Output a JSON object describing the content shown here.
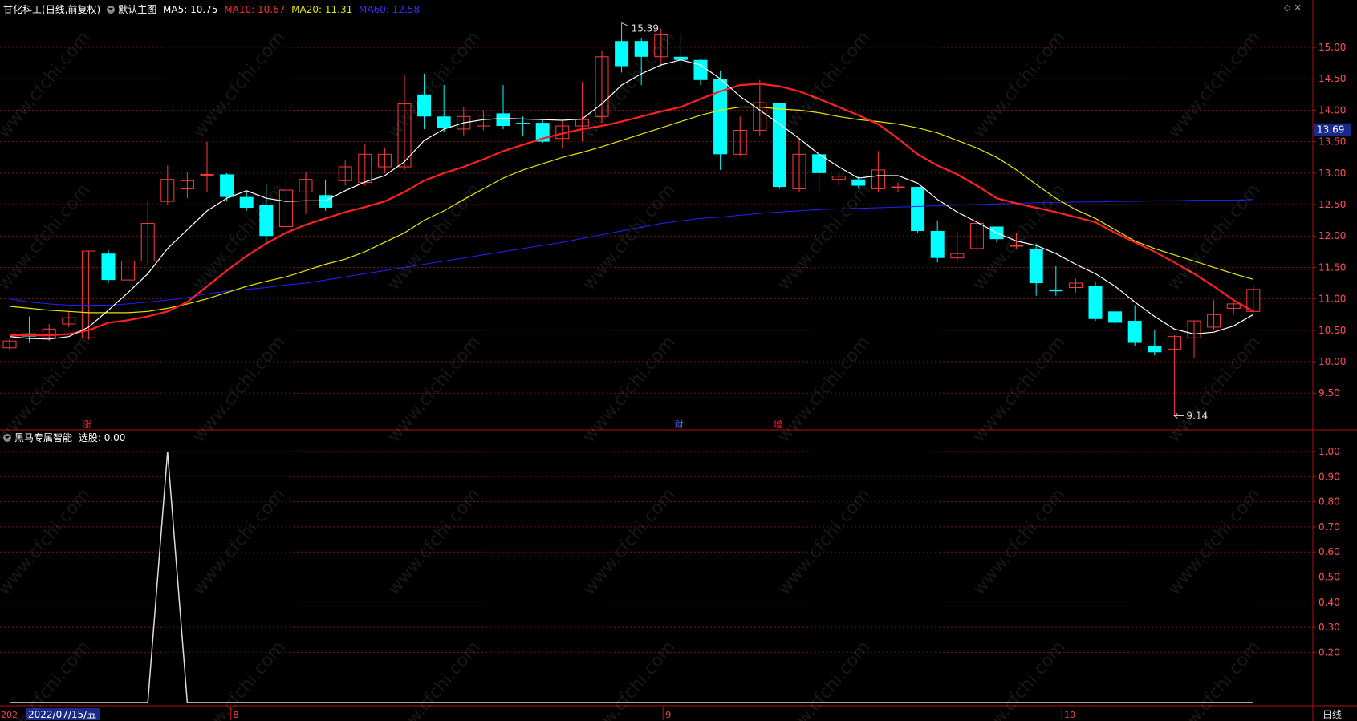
{
  "header": {
    "stock_name": "甘化科工",
    "period_label": "(日线,前复权)",
    "main_label": "默认主图",
    "ma5": "MA5: 10.75",
    "ma10": "MA10: 10.67",
    "ma20": "MA20: 11.31",
    "ma60": "MA60: 12.58"
  },
  "sub_header": {
    "indicator": "黑马专属智能",
    "value": "选股: 0.00"
  },
  "bottom_bar": {
    "date": "2022/07/15/五",
    "date_prefix": "202",
    "period": "日线"
  },
  "colors": {
    "up": "#ff3b3b",
    "down": "#00ffff",
    "ma5": "#ffffff",
    "ma10": "#ff2020",
    "ma20": "#e6e600",
    "ma60": "#2222ff",
    "grid": "#7a1010"
  },
  "events": [
    "涨",
    "财",
    "增"
  ],
  "watermark": "www.cfchi.com",
  "chart_data": [
    {
      "type": "candlestick",
      "y_axis_ticks": [
        "15.00",
        "14.50",
        "14.00",
        "13.50",
        "13.00",
        "12.50",
        "12.00",
        "11.50",
        "11.00",
        "10.50",
        "10.00",
        "9.50"
      ],
      "ylim": [
        9.0,
        15.6
      ],
      "current_price_label": "13.69",
      "high_label": "15.39",
      "low_label": "9.14",
      "x_tick_labels": [
        "8",
        "9",
        "10"
      ],
      "candles": [
        [
          10.22,
          10.33,
          10.17,
          10.38
        ],
        [
          10.45,
          10.4,
          10.3,
          10.72
        ],
        [
          10.38,
          10.52,
          10.33,
          10.6
        ],
        [
          10.6,
          10.7,
          10.55,
          10.8
        ],
        [
          10.38,
          11.76,
          10.35,
          11.76
        ],
        [
          11.72,
          11.3,
          11.25,
          11.78
        ],
        [
          11.3,
          11.6,
          11.28,
          11.68
        ],
        [
          11.6,
          12.2,
          11.55,
          12.55
        ],
        [
          12.55,
          12.9,
          12.5,
          13.12
        ],
        [
          12.75,
          12.88,
          12.6,
          13.02
        ],
        [
          12.98,
          12.98,
          12.7,
          13.5
        ],
        [
          12.98,
          12.62,
          12.55,
          13.0
        ],
        [
          12.62,
          12.45,
          12.4,
          12.7
        ],
        [
          12.5,
          12.0,
          11.88,
          12.82
        ],
        [
          12.15,
          12.73,
          12.1,
          12.9
        ],
        [
          12.7,
          12.9,
          12.35,
          13.02
        ],
        [
          12.65,
          12.45,
          12.4,
          12.9
        ],
        [
          12.88,
          13.1,
          12.8,
          13.2
        ],
        [
          12.85,
          13.3,
          12.8,
          13.46
        ],
        [
          13.1,
          13.3,
          13.0,
          13.4
        ],
        [
          13.1,
          14.1,
          13.05,
          14.56
        ],
        [
          14.25,
          13.9,
          13.7,
          14.58
        ],
        [
          13.9,
          13.72,
          13.65,
          14.4
        ],
        [
          13.7,
          13.9,
          13.6,
          14.05
        ],
        [
          13.75,
          13.92,
          13.68,
          14.0
        ],
        [
          13.95,
          13.75,
          13.7,
          14.4
        ],
        [
          13.8,
          13.78,
          13.6,
          13.9
        ],
        [
          13.8,
          13.5,
          13.48,
          13.85
        ],
        [
          13.55,
          13.75,
          13.4,
          13.85
        ],
        [
          13.75,
          13.85,
          13.5,
          14.45
        ],
        [
          13.9,
          14.85,
          13.8,
          14.95
        ],
        [
          15.1,
          14.7,
          14.6,
          15.39
        ],
        [
          15.1,
          14.85,
          14.4,
          15.15
        ],
        [
          14.85,
          15.2,
          14.7,
          15.3
        ],
        [
          14.85,
          14.8,
          14.7,
          15.22
        ],
        [
          14.8,
          14.48,
          14.4,
          14.82
        ],
        [
          14.5,
          13.3,
          13.05,
          14.62
        ],
        [
          13.3,
          13.68,
          13.28,
          13.9
        ],
        [
          13.68,
          14.12,
          13.6,
          14.48
        ],
        [
          14.12,
          12.78,
          12.75,
          14.12
        ],
        [
          12.75,
          13.3,
          12.7,
          13.55
        ],
        [
          13.3,
          13.0,
          12.7,
          13.3
        ],
        [
          12.9,
          12.95,
          12.8,
          13.0
        ],
        [
          12.9,
          12.8,
          12.75,
          12.95
        ],
        [
          12.75,
          13.05,
          12.7,
          13.35
        ],
        [
          12.78,
          12.78,
          12.7,
          12.85
        ],
        [
          12.78,
          12.08,
          12.05,
          12.78
        ],
        [
          12.08,
          11.65,
          11.58,
          12.25
        ],
        [
          11.65,
          11.72,
          11.6,
          12.05
        ],
        [
          11.8,
          12.2,
          11.78,
          12.35
        ],
        [
          12.15,
          11.95,
          11.9,
          12.15
        ],
        [
          11.85,
          11.85,
          11.8,
          12.05
        ],
        [
          11.8,
          11.25,
          11.05,
          11.88
        ],
        [
          11.15,
          11.12,
          11.05,
          11.52
        ],
        [
          11.18,
          11.25,
          11.1,
          11.32
        ],
        [
          11.2,
          10.68,
          10.65,
          11.28
        ],
        [
          10.8,
          10.62,
          10.55,
          10.82
        ],
        [
          10.65,
          10.3,
          10.25,
          10.9
        ],
        [
          10.25,
          10.15,
          10.1,
          10.5
        ],
        [
          10.2,
          10.4,
          9.14,
          10.42
        ],
        [
          10.38,
          10.65,
          10.05,
          10.65
        ],
        [
          10.55,
          10.75,
          10.5,
          10.98
        ],
        [
          10.85,
          10.92,
          10.75,
          10.95
        ],
        [
          10.8,
          11.15,
          10.78,
          11.22
        ]
      ],
      "ma5": [
        10.4,
        10.37,
        10.36,
        10.4,
        10.55,
        10.82,
        11.1,
        11.4,
        11.8,
        12.1,
        12.4,
        12.6,
        12.72,
        12.6,
        12.55,
        12.56,
        12.56,
        12.72,
        12.86,
        12.96,
        13.18,
        13.52,
        13.7,
        13.8,
        13.85,
        13.87,
        13.86,
        13.85,
        13.84,
        13.86,
        14.1,
        14.4,
        14.58,
        14.72,
        14.8,
        14.72,
        14.5,
        14.22,
        14.0,
        13.78,
        13.55,
        13.3,
        13.1,
        12.92,
        12.96,
        12.96,
        12.84,
        12.58,
        12.38,
        12.22,
        12.05,
        11.92,
        11.85,
        11.72,
        11.55,
        11.4,
        11.2,
        10.95,
        10.72,
        10.52,
        10.44,
        10.47,
        10.57,
        10.75
      ],
      "ma10": [
        10.42,
        10.42,
        10.42,
        10.44,
        10.5,
        10.62,
        10.66,
        10.72,
        10.8,
        10.95,
        11.2,
        11.45,
        11.68,
        11.88,
        12.05,
        12.18,
        12.28,
        12.38,
        12.46,
        12.55,
        12.7,
        12.88,
        13.0,
        13.1,
        13.22,
        13.35,
        13.45,
        13.55,
        13.63,
        13.7,
        13.75,
        13.82,
        13.9,
        13.98,
        14.05,
        14.18,
        14.3,
        14.4,
        14.42,
        14.38,
        14.3,
        14.18,
        14.05,
        13.92,
        13.78,
        13.55,
        13.3,
        13.12,
        12.98,
        12.8,
        12.6,
        12.52,
        12.45,
        12.38,
        12.3,
        12.22,
        12.05,
        11.9,
        11.75,
        11.58,
        11.4,
        11.2,
        10.98,
        10.8,
        10.7,
        10.67,
        10.67
      ],
      "ma20": [
        10.88,
        10.85,
        10.82,
        10.8,
        10.78,
        10.78,
        10.78,
        10.8,
        10.85,
        10.92,
        11.0,
        11.1,
        11.2,
        11.28,
        11.35,
        11.45,
        11.55,
        11.63,
        11.75,
        11.9,
        12.05,
        12.25,
        12.4,
        12.58,
        12.75,
        12.92,
        13.05,
        13.15,
        13.25,
        13.33,
        13.42,
        13.52,
        13.62,
        13.72,
        13.82,
        13.92,
        14.0,
        14.05,
        14.05,
        14.02,
        14.0,
        13.96,
        13.9,
        13.85,
        13.82,
        13.78,
        13.72,
        13.64,
        13.52,
        13.4,
        13.25,
        13.05,
        12.82,
        12.6,
        12.42,
        12.28,
        12.1,
        11.92,
        11.8,
        11.7,
        11.6,
        11.5,
        11.4,
        11.31
      ],
      "ma60": [
        11.0,
        10.95,
        10.92,
        10.9,
        10.9,
        10.9,
        10.92,
        10.95,
        10.98,
        11.02,
        11.08,
        11.12,
        11.15,
        11.18,
        11.22,
        11.25,
        11.3,
        11.35,
        11.4,
        11.45,
        11.5,
        11.55,
        11.6,
        11.65,
        11.7,
        11.75,
        11.8,
        11.85,
        11.9,
        11.96,
        12.02,
        12.08,
        12.14,
        12.2,
        12.24,
        12.28,
        12.3,
        12.33,
        12.36,
        12.38,
        12.4,
        12.42,
        12.43,
        12.44,
        12.45,
        12.46,
        12.47,
        12.48,
        12.49,
        12.5,
        12.51,
        12.52,
        12.53,
        12.53,
        12.54,
        12.54,
        12.55,
        12.55,
        12.56,
        12.56,
        12.57,
        12.57,
        12.57,
        12.58
      ]
    },
    {
      "type": "line",
      "name": "选股",
      "ylim": [
        0,
        1.05
      ],
      "y_axis_ticks": [
        "1.00",
        "0.90",
        "0.80",
        "0.70",
        "0.60",
        "0.50",
        "0.40",
        "0.30",
        "0.20"
      ],
      "values": [
        0,
        0,
        0,
        0,
        0,
        0,
        0,
        0,
        1,
        0,
        0,
        0,
        0,
        0,
        0,
        0,
        0,
        0,
        0,
        0,
        0,
        0,
        0,
        0,
        0,
        0,
        0,
        0,
        0,
        0,
        0,
        0,
        0,
        0,
        0,
        0,
        0,
        0,
        0,
        0,
        0,
        0,
        0,
        0,
        0,
        0,
        0,
        0,
        0,
        0,
        0,
        0,
        0,
        0,
        0,
        0,
        0,
        0,
        0,
        0,
        0,
        0,
        0,
        0
      ]
    }
  ]
}
